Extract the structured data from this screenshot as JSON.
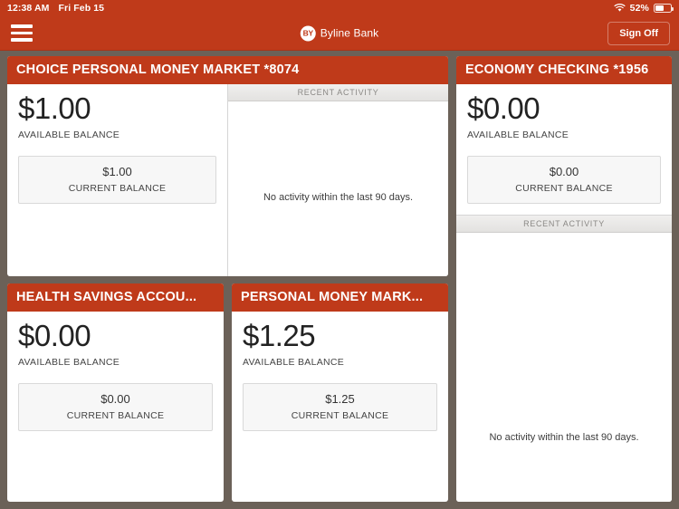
{
  "status_bar": {
    "time": "12:38 AM",
    "date": "Fri Feb 15",
    "battery_percent": "52%",
    "wifi_icon": "wifi-icon",
    "battery_icon": "battery-icon"
  },
  "app_bar": {
    "menu_icon": "hamburger-menu-icon",
    "brand_mark": "BY",
    "brand_name": "Byline Bank",
    "sign_off_label": "Sign Off"
  },
  "labels": {
    "available_balance": "AVAILABLE BALANCE",
    "current_balance": "CURRENT BALANCE",
    "recent_activity": "RECENT ACTIVITY",
    "no_activity": "No activity within the last 90 days."
  },
  "colors": {
    "brand_orange": "#bf3a1a",
    "page_background": "#6b6158",
    "card_background": "#ffffff"
  },
  "accounts": [
    {
      "title": "CHOICE PERSONAL MONEY MARKET *8074",
      "available_balance": "$1.00",
      "current_balance": "$1.00"
    },
    {
      "title": "ECONOMY CHECKING *1956",
      "available_balance": "$0.00",
      "current_balance": "$0.00"
    },
    {
      "title": "HEALTH SAVINGS ACCOU...",
      "available_balance": "$0.00",
      "current_balance": "$0.00"
    },
    {
      "title": "PERSONAL MONEY MARK...",
      "available_balance": "$1.25",
      "current_balance": "$1.25"
    }
  ]
}
